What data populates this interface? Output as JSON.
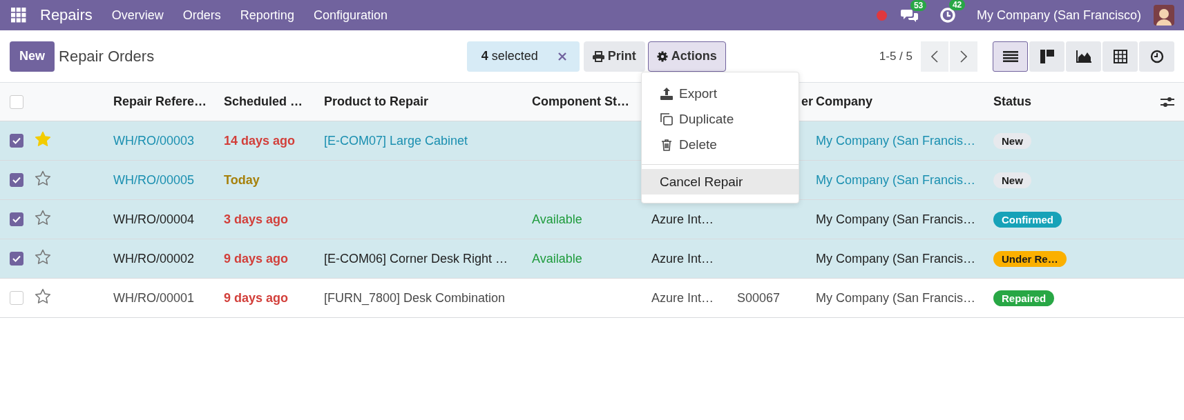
{
  "navbar": {
    "app_name": "Repairs",
    "menu": [
      {
        "label": "Overview"
      },
      {
        "label": "Orders"
      },
      {
        "label": "Reporting"
      },
      {
        "label": "Configuration"
      }
    ],
    "messages_count": "53",
    "activities_count": "42",
    "company": "My Company (San Francisco)"
  },
  "control_panel": {
    "new_button": "New",
    "title": "Repair Orders",
    "selection": {
      "count": "4",
      "label": "selected"
    },
    "print_button": "Print",
    "actions_button": "Actions",
    "pager": "1-5 / 5",
    "views": [
      {
        "kind": "list",
        "selected": true
      },
      {
        "kind": "kanban",
        "selected": false
      },
      {
        "kind": "graph",
        "selected": false
      },
      {
        "kind": "pivot",
        "selected": false
      },
      {
        "kind": "activity",
        "selected": false
      }
    ]
  },
  "actions_menu": [
    {
      "kind": "export",
      "label": "Export",
      "selected": false
    },
    {
      "kind": "duplicate",
      "label": "Duplicate",
      "selected": false
    },
    {
      "kind": "delete",
      "label": "Delete",
      "selected": false
    },
    {
      "kind": "divider"
    },
    {
      "kind": "plain",
      "label": "Cancel Repair",
      "selected": true
    }
  ],
  "table": {
    "all_selected": false,
    "columns": [
      {
        "label": "Repair Refere…"
      },
      {
        "label": "Scheduled …"
      },
      {
        "label": "Product to Repair"
      },
      {
        "label": "Component St…"
      },
      {
        "label": "er"
      },
      {
        "label": "Company"
      },
      {
        "label": "Status"
      }
    ],
    "rows": [
      {
        "selected": true,
        "starred": true,
        "reference": {
          "text": "WH/RO/00003",
          "link": true
        },
        "scheduled": {
          "text": "14 days ago",
          "color": "#d23f3a"
        },
        "product": {
          "text": "[E-COM07] Large Cabinet",
          "link": true
        },
        "company": {
          "text": "My Company (San Francis…",
          "link": true
        },
        "status": {
          "text": "New",
          "color": "#e7e9ed"
        }
      },
      {
        "selected": true,
        "starred": false,
        "reference": {
          "text": "WH/RO/00005",
          "link": true
        },
        "scheduled": {
          "text": "Today",
          "color": "#a6800a"
        },
        "company": {
          "text": "My Company (San Francis…",
          "link": true
        },
        "status": {
          "text": "New",
          "color": "#e7e9ed"
        }
      },
      {
        "selected": true,
        "starred": false,
        "reference": {
          "text": "WH/RO/00004",
          "link": false
        },
        "scheduled": {
          "text": "3 days ago",
          "color": "#d23f3a"
        },
        "component": "Available",
        "column_5": "Azure Int…",
        "company": {
          "text": "My Company (San Francis…",
          "link": false
        },
        "status": {
          "text": "Confirmed",
          "color": "#17a2b8"
        }
      },
      {
        "selected": true,
        "starred": false,
        "reference": {
          "text": "WH/RO/00002",
          "link": false
        },
        "scheduled": {
          "text": "9 days ago",
          "color": "#d23f3a"
        },
        "product": {
          "text": "[E-COM06] Corner Desk Right …",
          "link": false
        },
        "component": "Available",
        "column_5": "Azure Int…",
        "company": {
          "text": "My Company (San Francis…",
          "link": false
        },
        "status": {
          "text": "Under Re…",
          "color": "#fbb000"
        }
      },
      {
        "selected": false,
        "starred": false,
        "reference": {
          "text": "WH/RO/00001",
          "link": false
        },
        "scheduled": {
          "text": "9 days ago",
          "color": "#d23f3a"
        },
        "product": {
          "text": "[FURN_7800] Desk Combination",
          "link": false
        },
        "column_5": "Azure Int…",
        "column_6": "S00067",
        "company": {
          "text": "My Company (San Francis…",
          "link": false
        },
        "status": {
          "text": "Repaired",
          "color": "#28a745"
        }
      }
    ]
  }
}
